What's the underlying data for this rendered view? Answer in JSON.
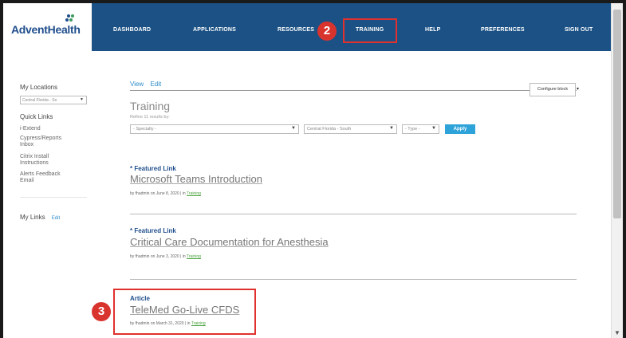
{
  "brand": {
    "name": "AdventHealth"
  },
  "nav": {
    "items": [
      {
        "label": "DASHBOARD"
      },
      {
        "label": "APPLICATIONS"
      },
      {
        "label": "RESOURCES"
      },
      {
        "label": "TRAINING"
      },
      {
        "label": "HELP"
      },
      {
        "label": "PREFERENCES"
      },
      {
        "label": "SIGN OUT"
      }
    ]
  },
  "annotations": {
    "step2": "2",
    "step3": "3"
  },
  "sidebar": {
    "my_locations_label": "My Locations",
    "location_selected": "Central Florida - So",
    "quick_links_label": "Quick Links",
    "quick_links": [
      "i-Extend",
      "Cypress/Reports Inbox",
      "Citrix Install Instructions",
      "Alerts Feedback Email"
    ],
    "my_links_label": "My Links",
    "my_links_edit": "Edit"
  },
  "main": {
    "tabs": [
      "View",
      "Edit"
    ],
    "configure_label": "Configure block",
    "title": "Training",
    "refine_text": "Refine 11 results by:",
    "filters": {
      "specialty": "- Specialty -",
      "location": "Central Florida - South",
      "type": "- Type -"
    },
    "apply_label": "Apply",
    "items": [
      {
        "kind": "* Featured Link",
        "title": "Microsoft Teams Introduction",
        "meta_prefix": "by fhadmin on June 8, 2020  |  in",
        "category": "Training"
      },
      {
        "kind": "* Featured Link",
        "title": "Critical Care Documentation for Anesthesia",
        "meta_prefix": "by fhadmin on June 3, 2020  |  in",
        "category": "Training"
      },
      {
        "kind": "Article",
        "title": "TeleMed Go-Live CFDS",
        "meta_prefix": "by fhadmin on March 31, 2020  |  in",
        "category": "Training"
      }
    ]
  },
  "colors": {
    "navbar": "#1b5184",
    "highlight": "#e0312e",
    "accent": "#2ea3d9",
    "category_link": "#4aa33f"
  }
}
